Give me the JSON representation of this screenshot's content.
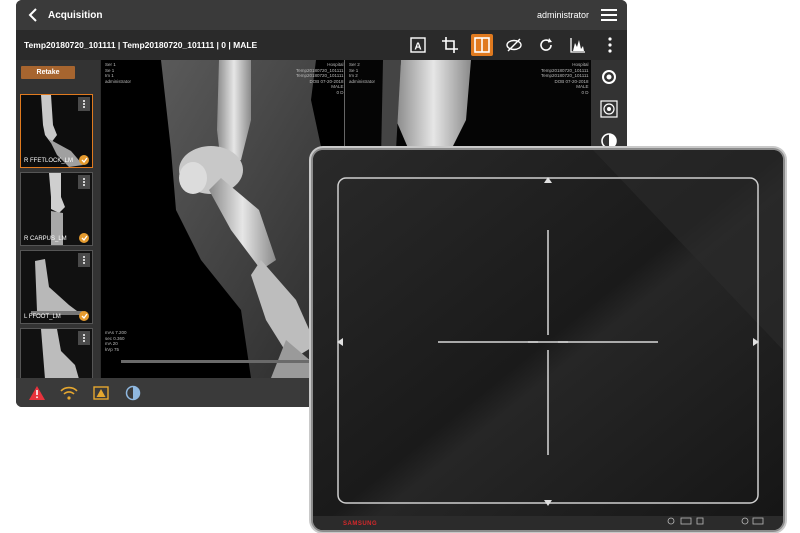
{
  "app": {
    "title": "Acquisition",
    "user": "administrator"
  },
  "patient": {
    "info": "Temp20180720_101111 | Temp20180720_101111 | 0 | MALE"
  },
  "toolbar": {
    "tools": [
      "annotation-icon",
      "crop-icon",
      "split-view-icon",
      "hide-icon",
      "rotate-icon",
      "histogram-icon",
      "more-vert-icon"
    ],
    "active_tool": "split-view-icon",
    "accent_color": "#e07a1f"
  },
  "thumbnails": {
    "retake_label": "Retake",
    "items": [
      {
        "label": "R FFETLOCK_LM",
        "accepted": true,
        "selected": true
      },
      {
        "label": "R CARPUS_LM",
        "accepted": true,
        "selected": false
      },
      {
        "label": "L FFOOT_LM",
        "accepted": true,
        "selected": false
      },
      {
        "label": "",
        "accepted": false,
        "selected": false
      }
    ]
  },
  "viewer": {
    "left_top_left": "Ser 1\nSe 1\nIm 1\nadministrator",
    "left_top_right": "Hospital\nTemp20180720_101111\nTemp20180720_101111\nDOB 07-20-2018\nMALE\n0 D",
    "left_bottom": "mAs 7.200\nsec 0.360\nmA 20\nkVp 75",
    "right_top_left": "Ser 2\nSe 1\nIm 2\nadministrator",
    "right_top_right": "Hospital\nTemp20180720_101111\nTemp20180720_101111\nDOB 07-20-2018\nMALE\n0 D"
  },
  "side_tools": [
    "settings-icon",
    "contrast-pattern-icon",
    "invert-icon"
  ],
  "status_bar": {
    "icons": [
      "warning-icon",
      "wifi-warning-icon",
      "detector-warning-icon",
      "battery-icon"
    ],
    "warning_color": "#e8333d"
  },
  "detector": {
    "brand": "SAMSUNG"
  }
}
